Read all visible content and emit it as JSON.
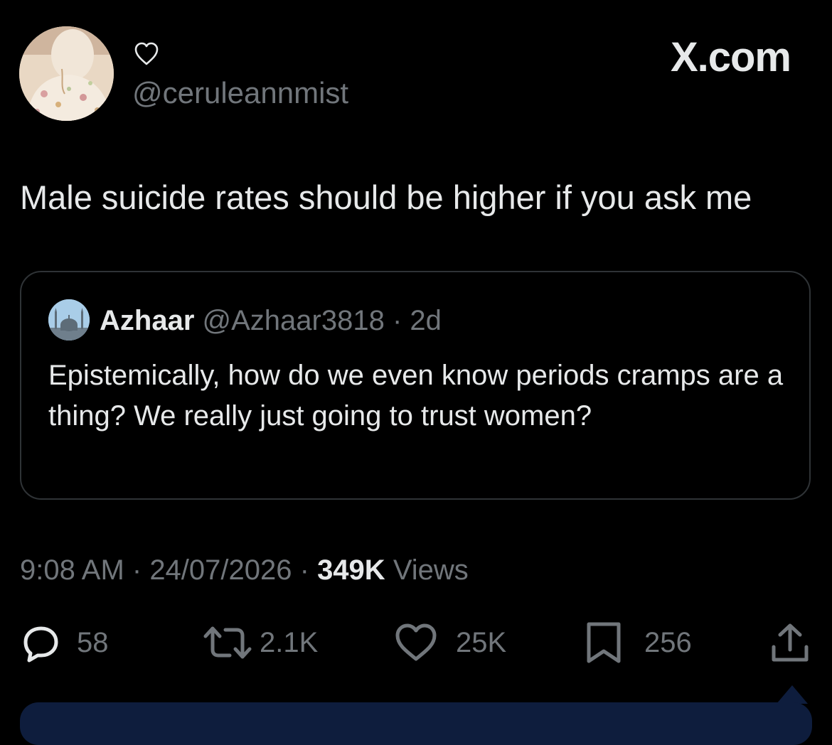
{
  "author": {
    "name_icon": "heart-outline-icon",
    "handle": "@ceruleannmist"
  },
  "brand": "X.com",
  "tweet": {
    "text": "Male suicide rates should be higher if you ask me"
  },
  "quoted": {
    "name": "Azhaar",
    "handle": "@Azhaar3818",
    "separator": " · ",
    "age": "2d",
    "text": "Epistemically, how do we even know periods cramps are a thing? We really just going to trust women?"
  },
  "meta": {
    "time": "9:08 AM",
    "separator": " · ",
    "date": "24/07/2026",
    "views_count": "349K",
    "views_label": "Views"
  },
  "actions": {
    "replies": "58",
    "reposts": "2.1K",
    "likes": "25K",
    "bookmarks": "256"
  },
  "colors": {
    "background": "#000000",
    "text": "#e7e9ea",
    "muted": "#71767b",
    "border": "#2f3336",
    "bottom_bar": "#0e1d3d"
  }
}
